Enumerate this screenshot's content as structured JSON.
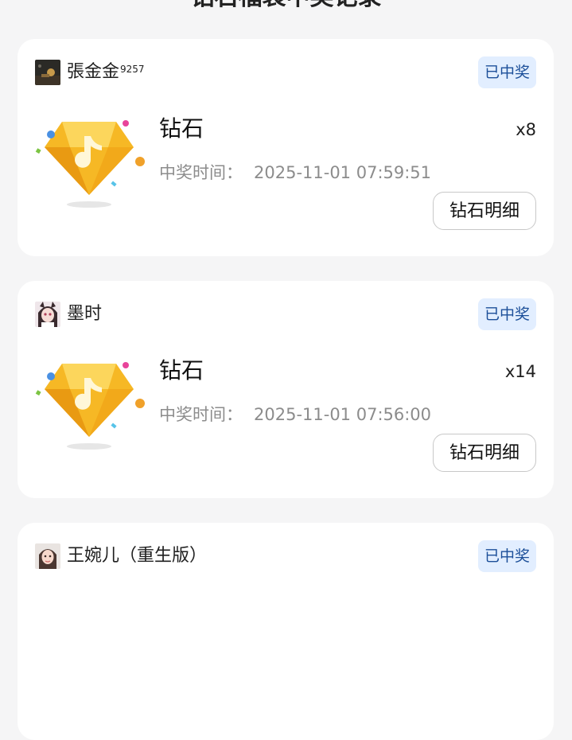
{
  "page": {
    "title": "钻石福袋中奖记录"
  },
  "records": [
    {
      "user": {
        "name": "張金金",
        "name_superscript": "9257",
        "avatar_icon": "dark-scene-avatar"
      },
      "status": "已中奖",
      "prize": {
        "name": "钻石",
        "quantity": "x8",
        "icon": "diamond-music-note-icon"
      },
      "time_label": "中奖时间：",
      "time_value": "2025-11-01 07:59:51",
      "detail_button": "钻石明细"
    },
    {
      "user": {
        "name": "墨时",
        "name_superscript": "",
        "avatar_icon": "anime-girl-avatar"
      },
      "status": "已中奖",
      "prize": {
        "name": "钻石",
        "quantity": "x14",
        "icon": "diamond-music-note-icon"
      },
      "time_label": "中奖时间：",
      "time_value": "2025-11-01 07:56:00",
      "detail_button": "钻石明细"
    },
    {
      "user": {
        "name": "王婉儿（重生版）",
        "name_superscript": "",
        "avatar_icon": "girl-portrait-avatar"
      },
      "status": "已中奖"
    }
  ],
  "colors": {
    "background": "#f5f5f6",
    "card": "#ffffff",
    "badge_bg": "#e2eeff",
    "badge_text": "#1c4f99",
    "diamond": "#f5b21b",
    "muted_text": "#8c8c8c"
  }
}
